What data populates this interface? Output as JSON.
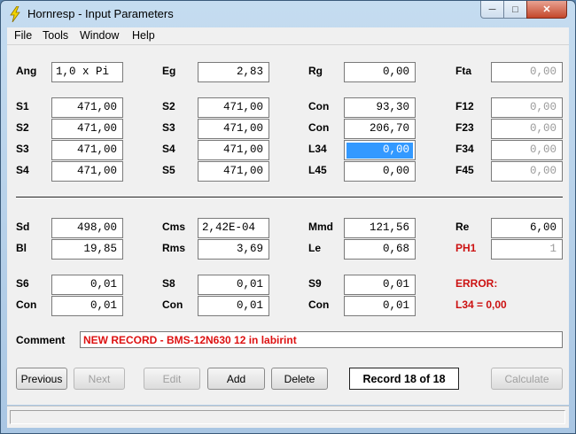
{
  "window": {
    "title": "Hornresp - Input Parameters"
  },
  "menu": [
    "File",
    "Tools",
    "Window",
    "Help"
  ],
  "fields": [
    {
      "label": "Ang",
      "value": "1,0 x Pi"
    },
    {
      "label": "Eg",
      "value": "2,83"
    },
    {
      "label": "Rg",
      "value": "0,00"
    },
    {
      "label": "Fta",
      "value": "0,00"
    },
    {
      "label": "S1",
      "value": "471,00"
    },
    {
      "label": "S2",
      "value": "471,00"
    },
    {
      "label": "Con",
      "value": "93,30"
    },
    {
      "label": "F12",
      "value": "0,00"
    },
    {
      "label": "S2",
      "value": "471,00"
    },
    {
      "label": "S3",
      "value": "471,00"
    },
    {
      "label": "Con",
      "value": "206,70"
    },
    {
      "label": "F23",
      "value": "0,00"
    },
    {
      "label": "S3",
      "value": "471,00"
    },
    {
      "label": "S4",
      "value": "471,00"
    },
    {
      "label": "L34",
      "value": "0,00"
    },
    {
      "label": "F34",
      "value": "0,00"
    },
    {
      "label": "S4",
      "value": "471,00"
    },
    {
      "label": "S5",
      "value": "471,00"
    },
    {
      "label": "L45",
      "value": "0,00"
    },
    {
      "label": "F45",
      "value": "0,00"
    },
    {
      "label": "Sd",
      "value": "498,00"
    },
    {
      "label": "Cms",
      "value": "2,42E-04"
    },
    {
      "label": "Mmd",
      "value": "121,56"
    },
    {
      "label": "Re",
      "value": "6,00"
    },
    {
      "label": "Bl",
      "value": "19,85"
    },
    {
      "label": "Rms",
      "value": "3,69"
    },
    {
      "label": "Le",
      "value": "0,68"
    },
    {
      "label": "PH1",
      "value": "1"
    },
    {
      "label": "S6",
      "value": "0,01"
    },
    {
      "label": "S8",
      "value": "0,01"
    },
    {
      "label": "S9",
      "value": "0,01"
    },
    {
      "label": "Con",
      "value": "0,01"
    },
    {
      "label": "Con",
      "value": "0,01"
    },
    {
      "label": "Con",
      "value": "0,01"
    }
  ],
  "error": {
    "heading": "ERROR:",
    "message": "L34 = 0,00"
  },
  "comment": {
    "label": "Comment",
    "value": "NEW RECORD - BMS-12N630 12 in labirint"
  },
  "buttons": [
    "Previous",
    "Next",
    "Edit",
    "Add",
    "Delete",
    "Calculate"
  ],
  "record": "Record 18 of 18",
  "colors": {
    "error_red": "#cc1111",
    "selection": "#3399ff"
  }
}
